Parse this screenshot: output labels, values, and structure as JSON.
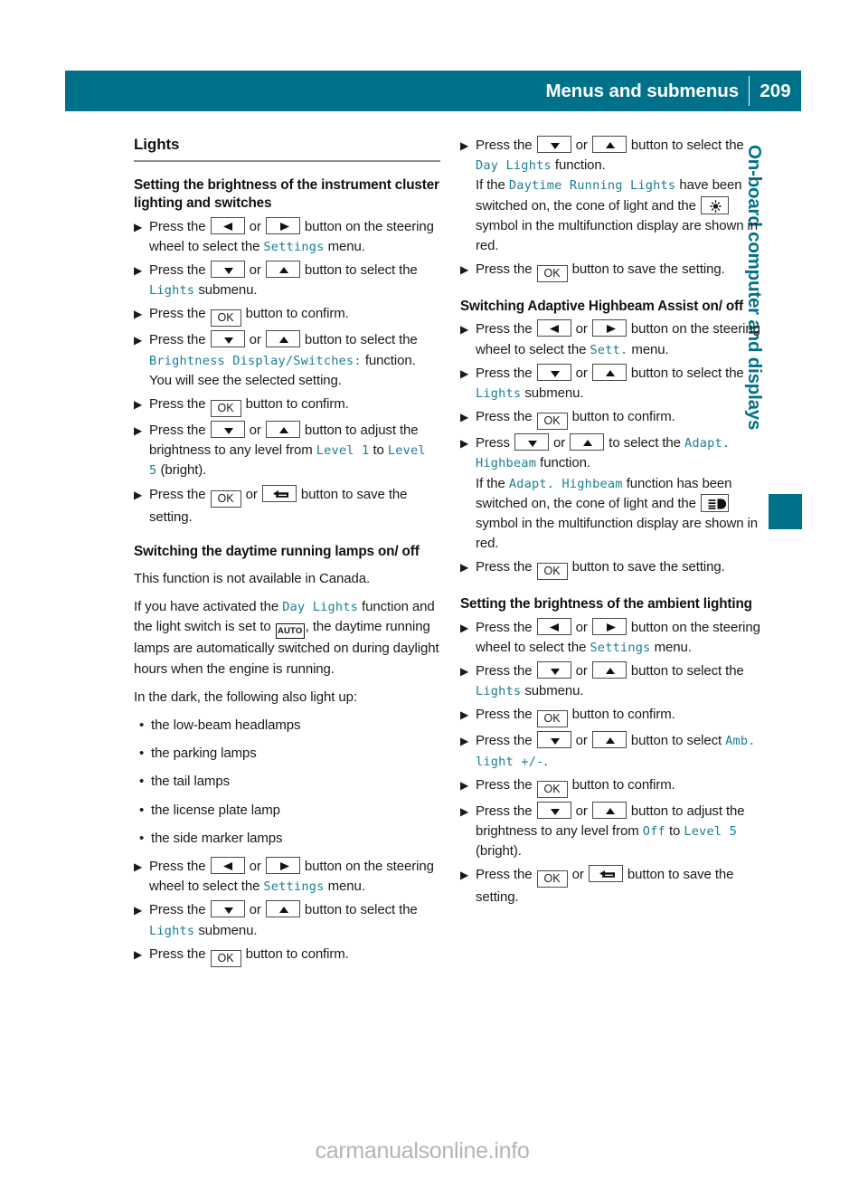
{
  "header": {
    "title": "Menus and submenus",
    "page_number": "209"
  },
  "side_tab": {
    "label": "On-board computer and displays"
  },
  "watermark": {
    "text": "carmanualsonline.info"
  },
  "colors": {
    "teal": "#00718a",
    "display_text": "#1b7e96",
    "rule": "#8e8e8e"
  },
  "icons": {
    "left": "left-arrow-button",
    "right": "right-arrow-button",
    "down": "down-arrow-button",
    "up": "up-arrow-button",
    "ok": "OK",
    "back": "back-button",
    "auto": "AUTO",
    "daytime_lights": "daytime-running-lights-symbol",
    "highbeam": "high-beam-symbol"
  },
  "left_column": {
    "section_title": "Lights",
    "block1": {
      "heading": "Setting the brightness of the instrument cluster lighting and switches",
      "s1_a": "Press the",
      "s1_or": "or",
      "s1_b": "button on the steering wheel to select the",
      "s1_menu": "Settings",
      "s1_c": "menu.",
      "s2_a": "Press the",
      "s2_or": "or",
      "s2_b": "button to select the",
      "s2_menu": "Lights",
      "s2_c": "submenu.",
      "s3_a": "Press the",
      "s3_b": "button to confirm.",
      "s4_a": "Press the",
      "s4_or": "or",
      "s4_b": "button to select the",
      "s4_menu": "Brightness Display/Switches:",
      "s4_c": "function.",
      "s4_note": "You will see the selected setting.",
      "s5_a": "Press the",
      "s5_b": "button to confirm.",
      "s6_a": "Press the",
      "s6_or": "or",
      "s6_b": "button to adjust the brightness to any level from",
      "s6_from": "Level 1",
      "s6_to_word": "to",
      "s6_to": "Level 5",
      "s6_c": "(bright).",
      "s7_a": "Press the",
      "s7_or": "or",
      "s7_b": "button to save the setting."
    },
    "block2": {
      "heading": "Switching the daytime running lamps on/ off",
      "p1": "This function is not available in Canada.",
      "p2_a": "If you have activated the",
      "p2_fn": "Day Lights",
      "p2_b": "function and the light switch is set to",
      "p2_c": ", the daytime running lamps are automatically switched on during daylight hours when the engine is running.",
      "p3": "In the dark, the following also light up:",
      "bullets": [
        "the low-beam headlamps",
        "the parking lamps",
        "the tail lamps",
        "the license plate lamp",
        "the side marker lamps"
      ],
      "s1_a": "Press the",
      "s1_or": "or",
      "s1_b": "button on the steering wheel to select the",
      "s1_menu": "Settings",
      "s1_c": "menu.",
      "s2_a": "Press the",
      "s2_or": "or",
      "s2_b": "button to select the",
      "s2_menu": "Lights",
      "s2_c": "submenu.",
      "s3_a": "Press the",
      "s3_b": "button to confirm."
    }
  },
  "right_column": {
    "block1": {
      "s1_a": "Press the",
      "s1_or": "or",
      "s1_b": "button to select the",
      "s1_fn": "Day Lights",
      "s1_c": "function.",
      "note_a": "If the",
      "note_fn": "Daytime Running Lights",
      "note_b": "have been switched on, the cone of light and the",
      "note_c": "symbol in the multifunction display are shown in red.",
      "s2_a": "Press the",
      "s2_b": "button to save the setting."
    },
    "block2": {
      "heading": "Switching Adaptive Highbeam Assist on/ off",
      "s1_a": "Press the",
      "s1_or": "or",
      "s1_b": "button on the steering wheel to select the",
      "s1_menu": "Sett.",
      "s1_c": "menu.",
      "s2_a": "Press the",
      "s2_or": "or",
      "s2_b": "button to select the",
      "s2_menu": "Lights",
      "s2_c": "submenu.",
      "s3_a": "Press the",
      "s3_b": "button to confirm.",
      "s4_a": "Press",
      "s4_or": "or",
      "s4_b": "to select the",
      "s4_fn": "Adapt. Highbeam",
      "s4_c": "function.",
      "note_a": "If the",
      "note_fn": "Adapt. Highbeam",
      "note_b": "function has been switched on, the cone of light and the",
      "note_c": "symbol in the multifunction display are shown in red.",
      "s5_a": "Press the",
      "s5_b": "button to save the setting."
    },
    "block3": {
      "heading": "Setting the brightness of the ambient lighting",
      "s1_a": "Press the",
      "s1_or": "or",
      "s1_b": "button on the steering wheel to select the",
      "s1_menu": "Settings",
      "s1_c": "menu.",
      "s2_a": "Press the",
      "s2_or": "or",
      "s2_b": "button to select the",
      "s2_menu": "Lights",
      "s2_c": "submenu.",
      "s3_a": "Press the",
      "s3_b": "button to confirm.",
      "s4_a": "Press the",
      "s4_or": "or",
      "s4_b": "button to select",
      "s4_fn": "Amb. light +/-",
      "s4_c": ".",
      "s5_a": "Press the",
      "s5_b": "button to confirm.",
      "s6_a": "Press the",
      "s6_or": "or",
      "s6_b": "button to adjust the brightness to any level from",
      "s6_from": "Off",
      "s6_to_word": "to",
      "s6_to": "Level 5",
      "s6_c": "(bright).",
      "s7_a": "Press the",
      "s7_or": "or",
      "s7_b": "button to save the setting."
    }
  }
}
